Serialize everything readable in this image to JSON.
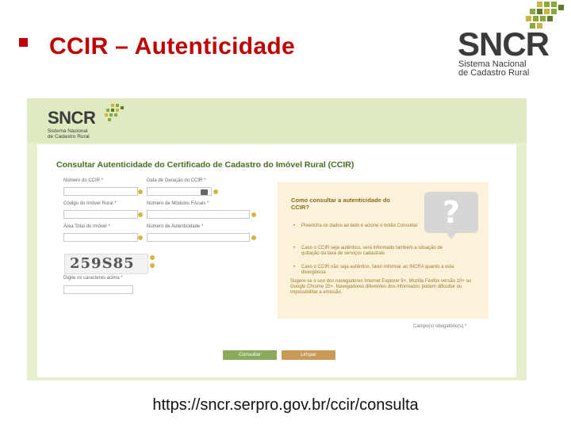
{
  "slide": {
    "title": "CCIR – Autenticidade",
    "url": "https://sncr.serpro.gov.br/ccir/consulta"
  },
  "logo": {
    "name": "SNCR",
    "line1": "Sistema Nacional",
    "line2": "de Cadastro Rural",
    "colors": [
      "#8aa83c",
      "#c8b54a",
      "#5e7b2a"
    ]
  },
  "page": {
    "form_title": "Consultar Autenticidade do Certificado de Cadastro do Imóvel Rural (CCIR)",
    "fields": {
      "numero_ccir": "Número do CCIR *",
      "data_geracao": "Data de Geração do CCIR *",
      "codigo_imovel": "Código do Imóvel Rural *",
      "numero_modulos": "Número de Módulos Fiscais *",
      "area_total": "Área Total do Imóvel *",
      "numero_autenticidade": "Número de Autenticidade *",
      "captcha_label": "Digite os caracteres acima *",
      "captcha_text": "259S85"
    },
    "help": {
      "title": "Como consultar a autenticidade do CCIR?",
      "items": [
        "Preencha os dados ao lado e acione o botão Consultar",
        "Caso o CCIR seja autêntico, será informado também a situação de quitação da taxa de serviços cadastrais",
        "Caso o CCIR não seja autêntico, favor informar ao INCRA quanto a esta divergência"
      ],
      "note": "Sugere-se o uso dos navegadores Internet Explorer 9+, Mozilla Firefox versão 10+ ou Google Chrome 25+. Navegadores diferentes dos informados podem dificultar ou impossibilitar a emissão."
    },
    "required_note": "Campo(s) obrigatório(s) *",
    "buttons": {
      "consultar": "Consultar",
      "limpar": "Limpar"
    }
  }
}
